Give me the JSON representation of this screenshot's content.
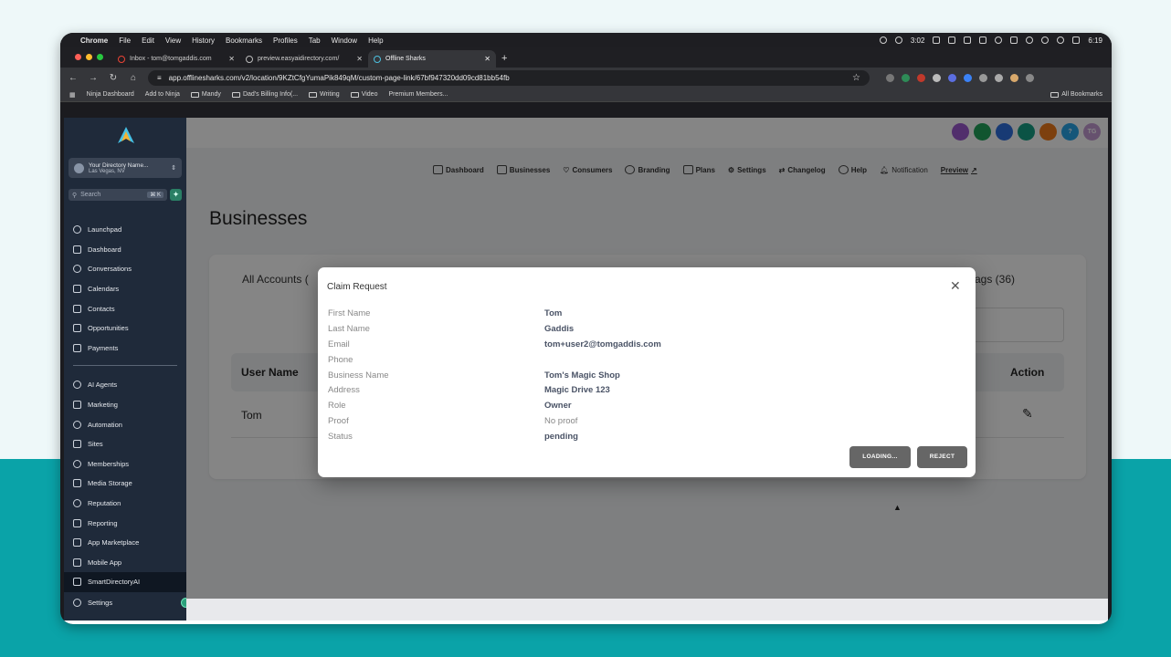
{
  "mac_menubar": {
    "app": "Chrome",
    "menus": [
      "File",
      "Edit",
      "View",
      "History",
      "Bookmarks",
      "Profiles",
      "Tab",
      "Window",
      "Help"
    ],
    "timer": "3:02",
    "clock": "6:19"
  },
  "browser": {
    "tabs": [
      {
        "title": "Inbox - tom@tomgaddis.com",
        "active": false
      },
      {
        "title": "preview.easyaidirectory.com/",
        "active": false
      },
      {
        "title": "Offline Sharks",
        "active": true
      }
    ],
    "url": "app.offlinesharks.com/v2/location/9KZtCfgYumaPik849qM/custom-page-link/67bf947320dd09cd81bb54fb",
    "bookmarks": [
      "Ninja Dashboard",
      "Add to Ninja",
      "Mandy",
      "Dad's Billing Info(...",
      "Writing",
      "Video",
      "Premium Members..."
    ],
    "all_bookmarks": "All Bookmarks"
  },
  "sidebar": {
    "location_name": "Your Directory Name...",
    "location_sub": "Las Vegas, NV",
    "search_placeholder": "Search",
    "search_shortcut": "⌘ K",
    "items_top": [
      "Launchpad",
      "Dashboard",
      "Conversations",
      "Calendars",
      "Contacts",
      "Opportunities",
      "Payments"
    ],
    "items_bottom": [
      "AI Agents",
      "Marketing",
      "Automation",
      "Sites",
      "Memberships",
      "Media Storage",
      "Reputation",
      "Reporting",
      "App Marketplace",
      "Mobile App",
      "SmartDirectoryAI"
    ],
    "settings": "Settings"
  },
  "topbar": {
    "avatar_initials": "TG",
    "help_glyph": "?"
  },
  "subnav": {
    "items": [
      "Dashboard",
      "Businesses",
      "Consumers",
      "Branding",
      "Plans",
      "Settings",
      "Changelog",
      "Help",
      "Notification",
      "Preview"
    ]
  },
  "page": {
    "title": "Businesses",
    "tab_all": "All Accounts (",
    "tab_flags": "ags (36)",
    "col_user": "User Name",
    "col_action": "Action",
    "row_name": "Tom"
  },
  "modal": {
    "title": "Claim Request",
    "fields": [
      {
        "label": "First Name",
        "value": "Tom"
      },
      {
        "label": "Last Name",
        "value": "Gaddis"
      },
      {
        "label": "Email",
        "value": "tom+user2@tomgaddis.com"
      },
      {
        "label": "Phone",
        "value": ""
      },
      {
        "label": "Business Name",
        "value": "Tom's Magic Shop"
      },
      {
        "label": "Address",
        "value": "Magic Drive 123"
      },
      {
        "label": "Role",
        "value": "Owner"
      },
      {
        "label": "Proof",
        "value": "No proof"
      },
      {
        "label": "Status",
        "value": "pending"
      }
    ],
    "btn_loading": "LOADING...",
    "btn_reject": "REJECT"
  },
  "colors": {
    "sidebar_bg": "#1f2a3a",
    "teal_bg": "#0aa3a8",
    "modal_button": "#666666"
  }
}
